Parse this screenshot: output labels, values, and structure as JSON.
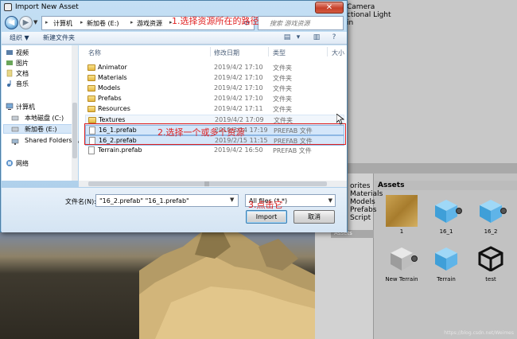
{
  "dialog": {
    "title": "Import New Asset",
    "close_label": "✕",
    "address_parts": [
      "计算机",
      "新加卷 (E:)",
      "游戏资源"
    ],
    "search_placeholder": "搜索 游戏资源",
    "toolbar": {
      "organize": "组织 ▼",
      "new_folder": "新建文件夹"
    },
    "nav_items": [
      {
        "label": "视频",
        "icon": "video-icon"
      },
      {
        "label": "图片",
        "icon": "pictures-icon"
      },
      {
        "label": "文档",
        "icon": "documents-icon"
      },
      {
        "label": "音乐",
        "icon": "music-icon"
      },
      {
        "label": "计算机",
        "icon": "computer-icon"
      },
      {
        "label": "本地磁盘 (C:)",
        "icon": "drive-icon"
      },
      {
        "label": "新加卷 (E:)",
        "icon": "drive-icon"
      },
      {
        "label": "Shared Folders (\\\\",
        "icon": "network-drive-icon"
      },
      {
        "label": "网络",
        "icon": "network-icon"
      }
    ],
    "columns": {
      "name": "名称",
      "date": "修改日期",
      "type": "类型",
      "size": "大小"
    },
    "files": [
      {
        "name": "Animator",
        "date": "2019/4/2 17:10",
        "type": "文件夹",
        "kind": "folder"
      },
      {
        "name": "Materials",
        "date": "2019/4/2 17:10",
        "type": "文件夹",
        "kind": "folder"
      },
      {
        "name": "Models",
        "date": "2019/4/2 17:10",
        "type": "文件夹",
        "kind": "folder"
      },
      {
        "name": "Prefabs",
        "date": "2019/4/2 17:10",
        "type": "文件夹",
        "kind": "folder"
      },
      {
        "name": "Resources",
        "date": "2019/4/2 17:11",
        "type": "文件夹",
        "kind": "folder"
      },
      {
        "name": "Textures",
        "date": "2019/4/2 17:09",
        "type": "文件夹",
        "kind": "folder"
      },
      {
        "name": "16_1.prefab",
        "date": "2019/2/14 17:19",
        "type": "PREFAB 文件",
        "kind": "file"
      },
      {
        "name": "16_2.prefab",
        "date": "2019/2/15 11:15",
        "type": "PREFAB 文件",
        "kind": "file"
      },
      {
        "name": "Terrain.prefab",
        "date": "2019/4/2 16:50",
        "type": "PREFAB 文件",
        "kind": "file"
      }
    ],
    "filename_label": "文件名(N):",
    "filename_value": "\"16_2.prefab\" \"16_1.prefab\"",
    "filter_value": "All files (*.*)",
    "import_label": "Import",
    "cancel_label": "取消"
  },
  "annotations": {
    "step1": "1.选择资源所在的路径",
    "step2": "2.选择一个或多个资源",
    "step3": "3.点击它"
  },
  "unity": {
    "hierarchy": [
      "Camera",
      "ctional Light",
      "in"
    ],
    "tree": [
      "orites",
      "Materials",
      "Models",
      "Prefabs",
      "Script"
    ],
    "assets_header": "Assets",
    "assets_sub": "Assets",
    "assets": [
      {
        "label": "1",
        "kind": "material"
      },
      {
        "label": "16_1",
        "kind": "cube"
      },
      {
        "label": "16_2",
        "kind": "cube"
      },
      {
        "label": "New Terrain",
        "kind": "terrain"
      },
      {
        "label": "Terrain",
        "kind": "cube"
      },
      {
        "label": "test",
        "kind": "unity"
      }
    ],
    "watermark": "https://blog.csdn.net/Weimes"
  }
}
